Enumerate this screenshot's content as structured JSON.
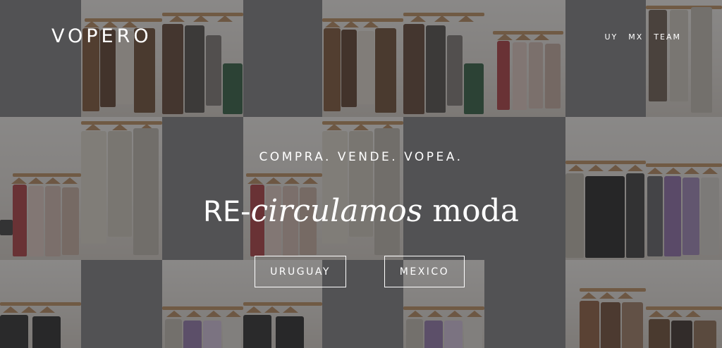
{
  "header": {
    "logo_text": "VOPERO",
    "nav": [
      {
        "label": "UY"
      },
      {
        "label": "MX"
      },
      {
        "label": "TEAM"
      }
    ]
  },
  "hero": {
    "tagline": "COMPRA. VENDE. VOPEA.",
    "headline_prefix": "RE-",
    "headline_italic": "circulamos",
    "headline_suffix": " moda",
    "buttons": [
      {
        "label": "URUGUAY"
      },
      {
        "label": "MEXICO"
      }
    ]
  },
  "colors": {
    "text": "#ffffff",
    "overlay": "#2a2a2c",
    "rail": "#b68a5c"
  }
}
